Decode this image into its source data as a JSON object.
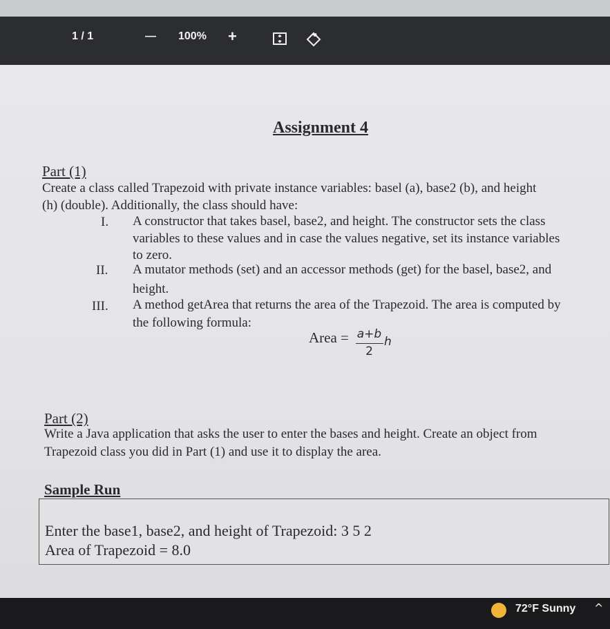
{
  "toolbar": {
    "page_indicator": "1 / 1",
    "zoom_out_label": "—",
    "zoom_level": "100%",
    "zoom_in_label": "+"
  },
  "document": {
    "title": "Assignment 4",
    "part1": {
      "heading": "Part (1)",
      "intro_lines": [
        "Create a class called Trapezoid with private instance variables: basel (a), base2 (b), and height",
        "(h) (double). Additionally, the class should have:"
      ],
      "items": [
        {
          "numeral": "I.",
          "lines": [
            "A constructor that takes basel, base2, and height. The constructor sets the class",
            "variables to these values and in case the values negative, set its instance variables",
            "to zero."
          ]
        },
        {
          "numeral": "II.",
          "lines": [
            "A mutator methods (set) and an accessor methods (get) for the basel, base2, and",
            "height."
          ]
        },
        {
          "numeral": "III.",
          "lines": [
            "A method getArea that returns the area of the Trapezoid. The area is computed by",
            "the following formula:"
          ]
        }
      ],
      "formula": {
        "lhs": "Area =",
        "numerator": "a+b",
        "denominator": "2",
        "factor": "h"
      }
    },
    "part2": {
      "heading": "Part (2)",
      "lines": [
        "Write a Java application that asks the user to enter the bases and height. Create an object from",
        "Trapezoid class you did in Part (1) and use it to display the area."
      ]
    },
    "sample_run": {
      "heading": "Sample Run",
      "lines": [
        "Enter the base1, base2, and height of Trapezoid: 3 5 2",
        "Area of Trapezoid = 8.0"
      ]
    }
  },
  "taskbar": {
    "weather": "72°F  Sunny",
    "tray_caret": "^"
  }
}
